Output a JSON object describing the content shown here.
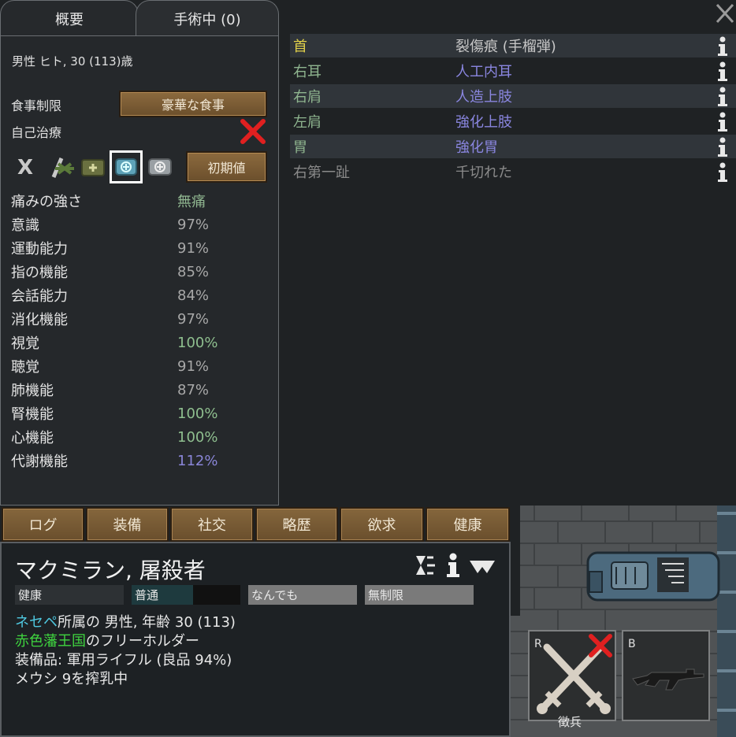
{
  "tabs": {
    "overview": "概要",
    "operations": "手術中 (0)"
  },
  "pawn_summary": "男性 ヒト, 30 (113)歳",
  "food_restriction": {
    "label": "食事制限",
    "value": "豪華な食事"
  },
  "self_tend": {
    "label": "自己治療"
  },
  "medicine_reset_label": "初期値",
  "medicine_x": "X",
  "capacities": [
    {
      "label": "痛みの強さ",
      "value": "無痛",
      "color": "#8fb58f"
    },
    {
      "label": "意識",
      "value": "97%",
      "color": "#a8a8a8"
    },
    {
      "label": "運動能力",
      "value": "91%",
      "color": "#a8a8a8"
    },
    {
      "label": "指の機能",
      "value": "85%",
      "color": "#a8a8a8"
    },
    {
      "label": "会話能力",
      "value": "84%",
      "color": "#a8a8a8"
    },
    {
      "label": "消化機能",
      "value": "97%",
      "color": "#a8a8a8"
    },
    {
      "label": "視覚",
      "value": "100%",
      "color": "#8fbf8f"
    },
    {
      "label": "聴覚",
      "value": "91%",
      "color": "#a8a8a8"
    },
    {
      "label": "肺機能",
      "value": "87%",
      "color": "#a8a8a8"
    },
    {
      "label": "腎機能",
      "value": "100%",
      "color": "#8fbf8f"
    },
    {
      "label": "心機能",
      "value": "100%",
      "color": "#8fbf8f"
    },
    {
      "label": "代謝機能",
      "value": "112%",
      "color": "#8a86d8"
    }
  ],
  "injuries": [
    {
      "part": "首",
      "condition": "裂傷痕 (手榴弾)",
      "part_color": "#e0d04a",
      "cond_color": "#c8c8c8"
    },
    {
      "part": "右耳",
      "condition": "人工内耳",
      "part_color": "#8fb58f",
      "cond_color": "#8a86e0"
    },
    {
      "part": "右肩",
      "condition": "人造上肢",
      "part_color": "#8fb58f",
      "cond_color": "#8a86e0"
    },
    {
      "part": "左肩",
      "condition": "強化上肢",
      "part_color": "#8fb58f",
      "cond_color": "#8a86e0"
    },
    {
      "part": "胃",
      "condition": "強化胃",
      "part_color": "#8fb58f",
      "cond_color": "#8a86e0"
    },
    {
      "part": "右第一趾",
      "condition": "千切れた",
      "part_color": "#8a8a8a",
      "cond_color": "#8a8a8a"
    }
  ],
  "bottom_tabs": [
    "ログ",
    "装備",
    "社交",
    "略歴",
    "欲求",
    "健康"
  ],
  "character": {
    "name": "マクミラン, 屠殺者",
    "bars": [
      "健康",
      "普通",
      "なんでも",
      "無制限"
    ],
    "faction_name": "ネセペ",
    "faction_suffix": "所属の 男性, 年齢 30 (113)",
    "empire_name": "赤色藩王国",
    "empire_suffix": "のフリーホルダー",
    "equipment": "装備品: 軍用ライフル (良品 94%)",
    "activity": "メウシ 9を搾乳中"
  },
  "weapon_slots": {
    "r_label": "R",
    "b_label": "B",
    "r_caption": "徴兵"
  },
  "colors": {
    "panel_bg": "#25282b",
    "border": "#6a6e72",
    "wood": "#7a5b34",
    "friendly_cyan": "#4fc8e0",
    "empire_green": "#3fd43f",
    "close_red": "#e02020"
  }
}
